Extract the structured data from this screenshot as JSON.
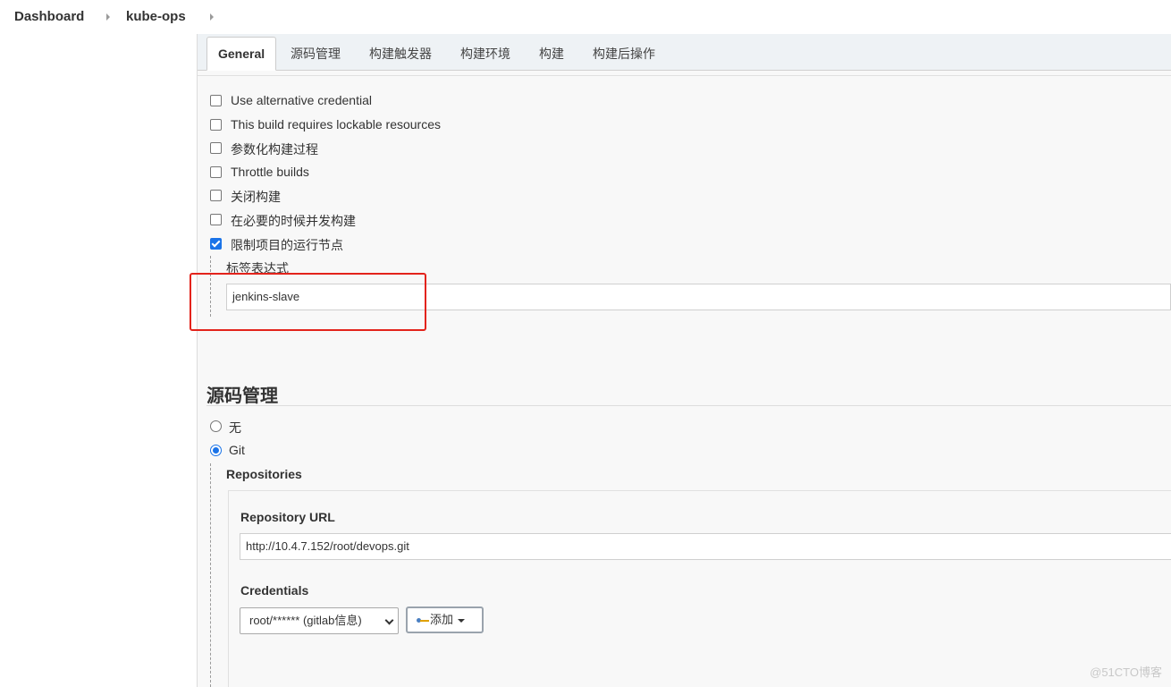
{
  "breadcrumb": {
    "items": [
      "Dashboard",
      "kube-ops"
    ]
  },
  "tabs": [
    "General",
    "源码管理",
    "构建触发器",
    "构建环境",
    "构建",
    "构建后操作"
  ],
  "active_tab": "General",
  "general": {
    "options": [
      {
        "label": "Use alternative credential",
        "checked": false
      },
      {
        "label": "This build requires lockable resources",
        "checked": false
      },
      {
        "label": "参数化构建过程",
        "checked": false
      },
      {
        "label": "Throttle builds",
        "checked": false
      },
      {
        "label": "关闭构建",
        "checked": false
      },
      {
        "label": "在必要的时候并发构建",
        "checked": false
      },
      {
        "label": "限制项目的运行节点",
        "checked": true
      }
    ],
    "label_expression": {
      "label": "标签表达式",
      "value": "jenkins-slave"
    }
  },
  "scm": {
    "title": "源码管理",
    "options": [
      {
        "label": "无",
        "selected": false
      },
      {
        "label": "Git",
        "selected": true
      }
    ],
    "repositories_label": "Repositories",
    "repo_url_label": "Repository URL",
    "repo_url_value": "http://10.4.7.152/root/devops.git",
    "credentials_label": "Credentials",
    "credentials_value": "root/****** (gitlab信息)",
    "add_button_label": "添加"
  },
  "watermark": "@51CTO博客",
  "colors": {
    "accent": "#1a73e8",
    "highlight": "#e3231b"
  }
}
